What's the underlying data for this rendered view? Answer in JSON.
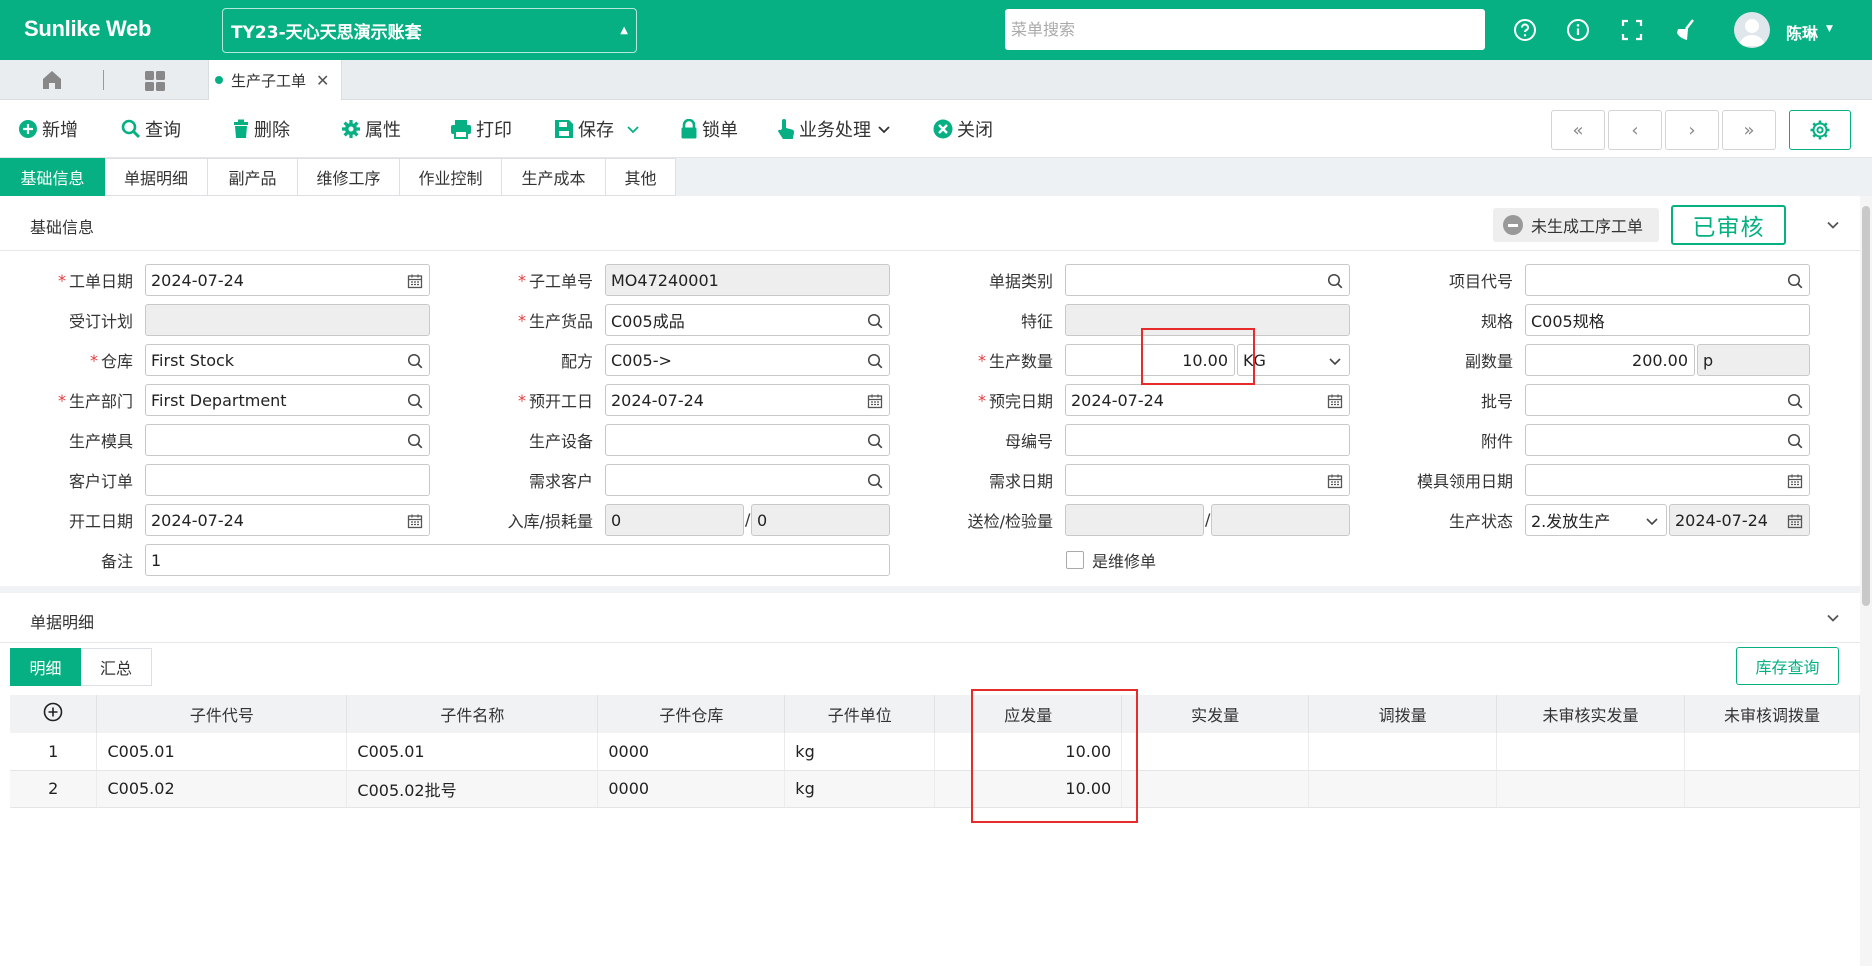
{
  "header": {
    "brand": "Sunlike Web",
    "account": "TY23-天心天思演示账套",
    "search_placeholder": "菜单搜索",
    "user_name": "陈琳"
  },
  "tabs": {
    "active_tab": "生产子工单"
  },
  "toolbar": {
    "add": "新增",
    "query": "查询",
    "delete": "删除",
    "properties": "属性",
    "print": "打印",
    "save": "保存",
    "lock": "锁单",
    "business": "业务处理",
    "close": "关闭",
    "nav_first": "«",
    "nav_prev": "‹",
    "nav_next": "›",
    "nav_last": "»"
  },
  "section_tabs": [
    "基础信息",
    "单据明细",
    "副产品",
    "维修工序",
    "作业控制",
    "生产成本",
    "其他"
  ],
  "basic": {
    "title": "基础信息",
    "status_text": "未生成工序工单",
    "audit_text": "已审核",
    "labels": {
      "order_date": "工单日期",
      "sub_order_no": "子工单号",
      "doc_type": "单据类别",
      "project_code": "项目代号",
      "plan": "受订计划",
      "product": "生产货品",
      "feature": "特征",
      "spec": "规格",
      "warehouse": "仓库",
      "formula": "配方",
      "qty": "生产数量",
      "sub_qty": "副数量",
      "dept": "生产部门",
      "start_plan": "预开工日",
      "finish_plan": "预完日期",
      "batch": "批号",
      "mold": "生产模具",
      "equipment": "生产设备",
      "parent_no": "母编号",
      "attachment": "附件",
      "customer_order": "客户订单",
      "demand_customer": "需求客户",
      "demand_date": "需求日期",
      "mold_date": "模具领用日期",
      "start_date": "开工日期",
      "in_loss": "入库/损耗量",
      "inspect": "送检/检验量",
      "prod_status": "生产状态",
      "remark": "备注",
      "is_repair": "是维修单"
    },
    "values": {
      "order_date": "2024-07-24",
      "sub_order_no": "MO47240001",
      "doc_type": "",
      "project_code": "",
      "plan": "",
      "product": "C005成品",
      "feature": "",
      "spec": "C005规格",
      "warehouse": "First Stock",
      "formula": "C005->",
      "qty": "10.00",
      "unit": "KG",
      "sub_qty": "200.00",
      "sub_unit": "p",
      "dept": "First Department",
      "start_plan": "2024-07-24",
      "finish_plan": "2024-07-24",
      "batch": "",
      "mold": "",
      "equipment": "",
      "parent_no": "",
      "attachment": "",
      "customer_order": "",
      "demand_customer": "",
      "demand_date": "",
      "mold_date": "",
      "start_date": "2024-07-24",
      "in_qty": "0",
      "loss_qty": "0",
      "inspect_qty": "",
      "checked_qty": "",
      "prod_status": "2.发放生产",
      "status_date": "2024-07-24",
      "remark": "1",
      "slash": "/"
    }
  },
  "detail": {
    "title": "单据明细",
    "subtabs": [
      "明细",
      "汇总"
    ],
    "stock_query": "库存查询",
    "columns": [
      "子件代号",
      "子件名称",
      "子件仓库",
      "子件单位",
      "应发量",
      "实发量",
      "调拨量",
      "未审核实发量",
      "未审核调拨量"
    ],
    "rows": [
      {
        "idx": "1",
        "code": "C005.01",
        "name": "C005.01",
        "wh": "0000",
        "unit": "kg",
        "due": "10.00",
        "actual": "",
        "transfer": "",
        "un_actual": "",
        "un_transfer": ""
      },
      {
        "idx": "2",
        "code": "C005.02",
        "name": "C005.02批号",
        "wh": "0000",
        "unit": "kg",
        "due": "10.00",
        "actual": "",
        "transfer": "",
        "un_actual": "",
        "un_transfer": ""
      }
    ]
  },
  "colors": {
    "primary": "#07b083",
    "highlight": "#e62b2b"
  }
}
